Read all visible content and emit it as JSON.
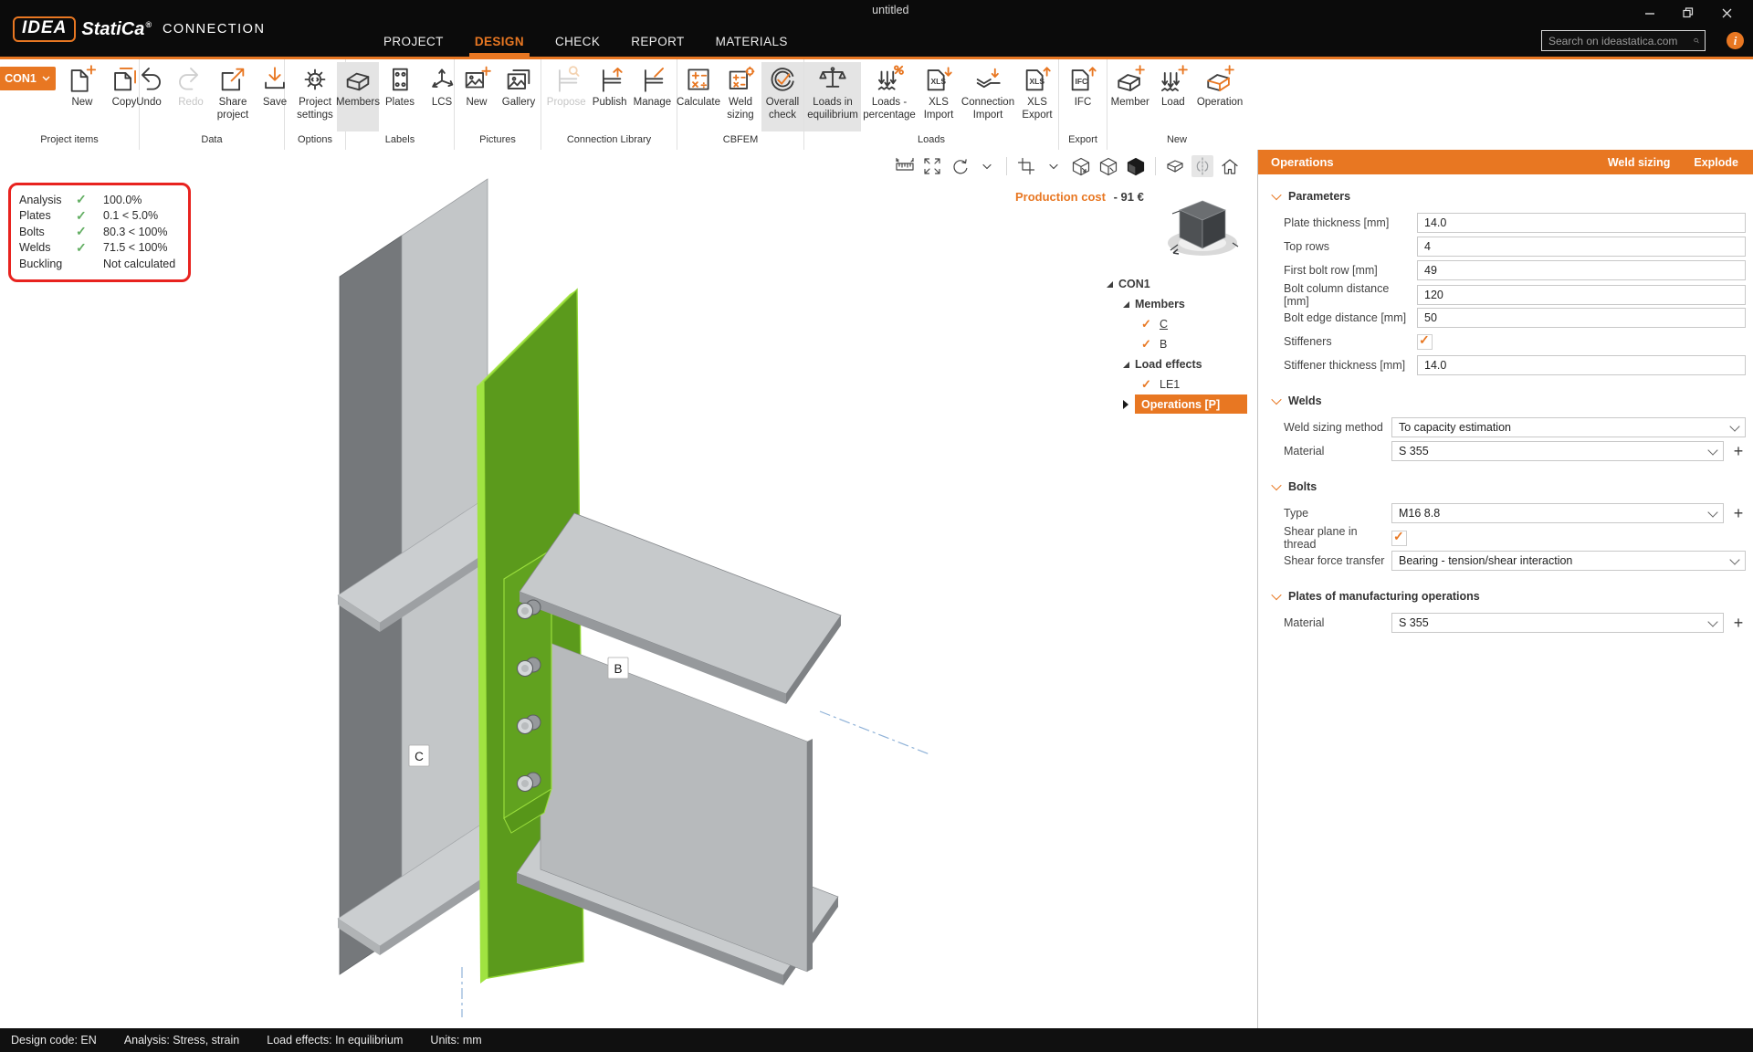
{
  "colors": {
    "accent": "#e87722",
    "check_green": "#62ae62",
    "annotation_red": "#e8231f",
    "plate_green": "#5b9a1c",
    "plate_green_edge": "#9ce13f",
    "steel_light": "#c6c9cb",
    "steel_dark": "#75787b"
  },
  "titlebar": {
    "title": "untitled"
  },
  "logo": {
    "idea": "IDEA",
    "statica": "StatiCa",
    "reg": "®",
    "product": "CONNECTION"
  },
  "menu": {
    "tabs": [
      {
        "label": "PROJECT"
      },
      {
        "label": "DESIGN"
      },
      {
        "label": "CHECK"
      },
      {
        "label": "REPORT"
      },
      {
        "label": "MATERIALS"
      }
    ]
  },
  "search": {
    "placeholder": "Search on ideastatica.com"
  },
  "info_glyph": "i",
  "ribbon": {
    "con1": "CON1",
    "groups": [
      {
        "label": "Project items",
        "items": [
          {
            "label": "New"
          },
          {
            "label": "Copy"
          }
        ]
      },
      {
        "label": "Data",
        "items": [
          {
            "label": "Undo"
          },
          {
            "label": "Redo"
          },
          {
            "label": "Share project"
          },
          {
            "label": "Save"
          }
        ]
      },
      {
        "label": "Options",
        "items": [
          {
            "label": "Project settings"
          }
        ]
      },
      {
        "label": "Labels",
        "items": [
          {
            "label": "Members"
          },
          {
            "label": "Plates"
          },
          {
            "label": "LCS"
          }
        ]
      },
      {
        "label": "Pictures",
        "items": [
          {
            "label": "New"
          },
          {
            "label": "Gallery"
          }
        ]
      },
      {
        "label": "Connection Library",
        "items": [
          {
            "label": "Propose"
          },
          {
            "label": "Publish"
          },
          {
            "label": "Manage"
          }
        ]
      },
      {
        "label": "CBFEM",
        "items": [
          {
            "label": "Calculate"
          },
          {
            "label": "Weld sizing"
          },
          {
            "label": "Overall check"
          }
        ]
      },
      {
        "label": "Loads",
        "items": [
          {
            "label": "Loads in equilibrium"
          },
          {
            "label": "Loads - percentage"
          },
          {
            "label": "XLS Import",
            "icon_text": "XLS"
          },
          {
            "label": "Connection Import"
          },
          {
            "label": "XLS Export",
            "icon_text": "XLS"
          }
        ]
      },
      {
        "label": "Export",
        "items": [
          {
            "label": "IFC",
            "icon_text": "IFC"
          }
        ]
      },
      {
        "label": "New",
        "items": [
          {
            "label": "Member"
          },
          {
            "label": "Load"
          },
          {
            "label": "Operation"
          }
        ]
      }
    ]
  },
  "checks": {
    "tick": "✓",
    "rows": [
      {
        "name": "Analysis",
        "tick": "✓",
        "value": "100.0%"
      },
      {
        "name": "Plates",
        "tick": "✓",
        "value": "0.1 < 5.0%"
      },
      {
        "name": "Bolts",
        "tick": "✓",
        "value": "80.3 < 100%"
      },
      {
        "name": "Welds",
        "tick": "✓",
        "value": "71.5 < 100%"
      },
      {
        "name": "Buckling",
        "tick": "",
        "value": "Not calculated"
      }
    ]
  },
  "viewport": {
    "production_cost_label": "Production cost",
    "production_cost_value": "- 91 €",
    "labels": {
      "beam": "B",
      "column": "C"
    }
  },
  "tree": {
    "check": "✓",
    "root": "CON1",
    "members_label": "Members",
    "member_c": "C",
    "member_b": "B",
    "loads_label": "Load effects",
    "load_le1": "LE1",
    "operations_label": "Operations [P]"
  },
  "panel": {
    "title": "Operations",
    "action_weld": "Weld sizing",
    "action_explode": "Explode",
    "parameters": {
      "title": "Parameters",
      "rows": [
        {
          "label": "Plate thickness [mm]",
          "value": "14.0"
        },
        {
          "label": "Top rows",
          "value": "4"
        },
        {
          "label": "First bolt row [mm]",
          "value": "49"
        },
        {
          "label": "Bolt column distance [mm]",
          "value": "120"
        },
        {
          "label": "Bolt edge distance [mm]",
          "value": "50"
        },
        {
          "label": "Stiffeners",
          "value": ""
        },
        {
          "label": "Stiffener thickness [mm]",
          "value": "14.0"
        }
      ]
    },
    "welds": {
      "title": "Welds",
      "rows": [
        {
          "label": "Weld sizing method",
          "value": "To capacity estimation"
        },
        {
          "label": "Material",
          "value": "S 355"
        }
      ]
    },
    "bolts": {
      "title": "Bolts",
      "rows": [
        {
          "label": "Type",
          "value": "M16 8.8"
        },
        {
          "label": "Shear plane in thread",
          "value": ""
        },
        {
          "label": "Shear force transfer",
          "value": "Bearing - tension/shear interaction"
        }
      ]
    },
    "plates_ops": {
      "title": "Plates of manufacturing operations",
      "rows": [
        {
          "label": "Material",
          "value": "S 355"
        }
      ]
    },
    "plus_glyph": "+"
  },
  "statusbar": {
    "items": [
      {
        "label": "Design code: EN"
      },
      {
        "label": "Analysis: Stress, strain"
      },
      {
        "label": "Load effects: In equilibrium"
      },
      {
        "label": "Units: mm"
      }
    ]
  }
}
